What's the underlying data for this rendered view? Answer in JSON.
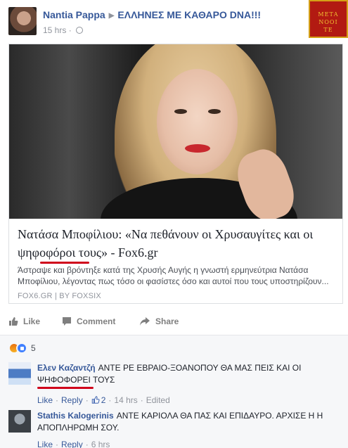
{
  "post": {
    "author": "Nantia Pappa",
    "group": "ΕΛΛΗΝΕΣ ΜΕ ΚΑΘΑΡΟ DNA!!!",
    "time": "15 hrs",
    "separator": "·",
    "group_logo_line1": "ΜΕΤΑ",
    "group_logo_line2": "ΝΟΟΙ",
    "group_logo_line3": "ΤΕ"
  },
  "link": {
    "title": "Νατάσα Μποφίλιου: «Να πεθάνουν οι Χρυσαυγίτες και οι ψηφοφόροι τους» - Fox6.gr",
    "description_line1": "Άστραψε και βρόντηξε κατά της Χρυσής Αυγής η γνωστή ερμηνεύτρια Νατάσα",
    "description_line2": "Μποφίλιου, λέγοντας πως τόσο οι φασίστες όσο και αυτοί που τους υποστηρίζουν...",
    "source": "FOX6.GR | BY FOXSIX"
  },
  "actions": {
    "like": "Like",
    "comment": "Comment",
    "share": "Share"
  },
  "reactions": {
    "count": "5"
  },
  "comments": [
    {
      "name": "Ελεν Καζαντζή",
      "text": "ΑΝΤΕ ΡΕ ΕΒΡΑΙΟ-ΞΟΑΝΟΠΟΥ ΘΑ ΜΑΣ ΠΕΙΣ ΚΑΙ ΟΙ ΨΗΦΟΦΟΡΕΙ ΤΟΥΣ",
      "like": "Like",
      "reply": "Reply",
      "likes": "2",
      "time": "14 hrs",
      "edited": "Edited"
    },
    {
      "name": "Stathis Kalogerinis",
      "text": "ΑΝΤΕ ΚΑΡΙΟΛΑ ΘΑ ΠΑΣ ΚΑΙ ΕΠΙΔΑΥΡΟ. ΑΡΧΙΣΕ Η Η ΑΠΟΠΛΗΡΩΜΗ ΣΟΥ.",
      "like": "Like",
      "reply": "Reply",
      "time": "6 hrs"
    }
  ],
  "colors": {
    "link_blue": "#365899",
    "meta_gray": "#90949c",
    "highlight_red": "#d0021b",
    "logo_red": "#b21a12"
  }
}
